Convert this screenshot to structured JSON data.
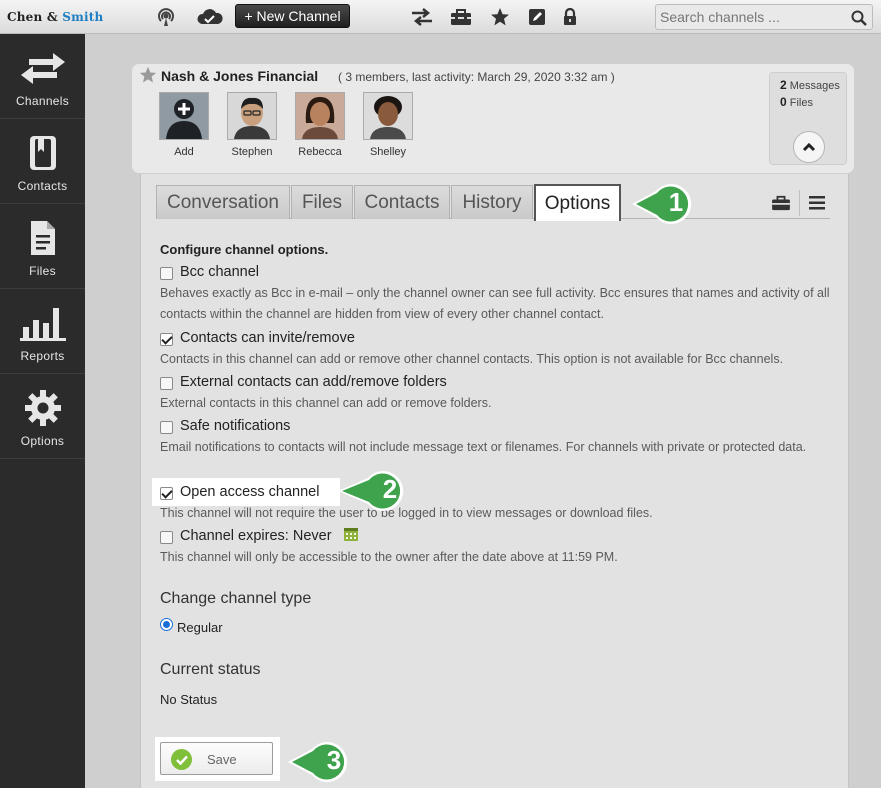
{
  "brand": {
    "part1": "Chen",
    "amp": "&",
    "part2": "Smith"
  },
  "toolbar": {
    "new_channel_label": "+ New Channel",
    "search_placeholder": "Search channels ..."
  },
  "sidebar": {
    "items": [
      {
        "label": "Channels",
        "icon": "arrows-icon"
      },
      {
        "label": "Contacts",
        "icon": "contacts-book-icon"
      },
      {
        "label": "Files",
        "icon": "file-icon"
      },
      {
        "label": "Reports",
        "icon": "bar-chart-icon"
      },
      {
        "label": "Options",
        "icon": "gear-icon"
      }
    ]
  },
  "channel": {
    "title": "Nash & Jones Financial",
    "meta": "( 3 members, last activity: March 29, 2020 3:32 am )",
    "members": [
      {
        "name": "Add"
      },
      {
        "name": "Stephen"
      },
      {
        "name": "Rebecca"
      },
      {
        "name": "Shelley"
      }
    ],
    "stats": {
      "messages_count": "2",
      "messages_label": "Messages",
      "files_count": "0",
      "files_label": "Files"
    }
  },
  "tabs": [
    {
      "label": "Conversation"
    },
    {
      "label": "Files"
    },
    {
      "label": "Contacts"
    },
    {
      "label": "History"
    },
    {
      "label": "Options",
      "active": true
    }
  ],
  "callouts": [
    "1",
    "2",
    "3"
  ],
  "options": {
    "section_title": "Configure channel options.",
    "items": [
      {
        "label": "Bcc channel",
        "checked": false,
        "desc": "Behaves exactly as Bcc in e-mail – only the channel owner can see full activity. Bcc ensures that names and activity of all contacts within the channel are hidden from view of every other channel contact."
      },
      {
        "label": "Contacts can invite/remove",
        "checked": true,
        "desc": "Contacts in this channel can add or remove other channel contacts. This option is not available for Bcc channels."
      },
      {
        "label": "External contacts can add/remove folders",
        "checked": false,
        "desc": "External contacts in this channel can add or remove folders."
      },
      {
        "label": "Safe notifications",
        "checked": false,
        "desc": "Email notifications to contacts will not include message text or filenames. For channels with private or protected data."
      },
      {
        "label": "Open access channel",
        "checked": true,
        "desc": "This channel will not require the user to be logged in to view messages or download files."
      },
      {
        "label": "Channel expires: Never",
        "checked": false,
        "desc": "This channel will only be accessible to the owner after the date above at 11:59 PM."
      }
    ],
    "channel_type_heading": "Change channel type",
    "channel_type_value": "Regular",
    "status_heading": "Current status",
    "status_value": "No Status",
    "save_label": "Save"
  },
  "colors": {
    "accent_green": "#3fa34d",
    "brand_blue": "#1f7fc4",
    "sidebar": "#2b2b2b"
  }
}
